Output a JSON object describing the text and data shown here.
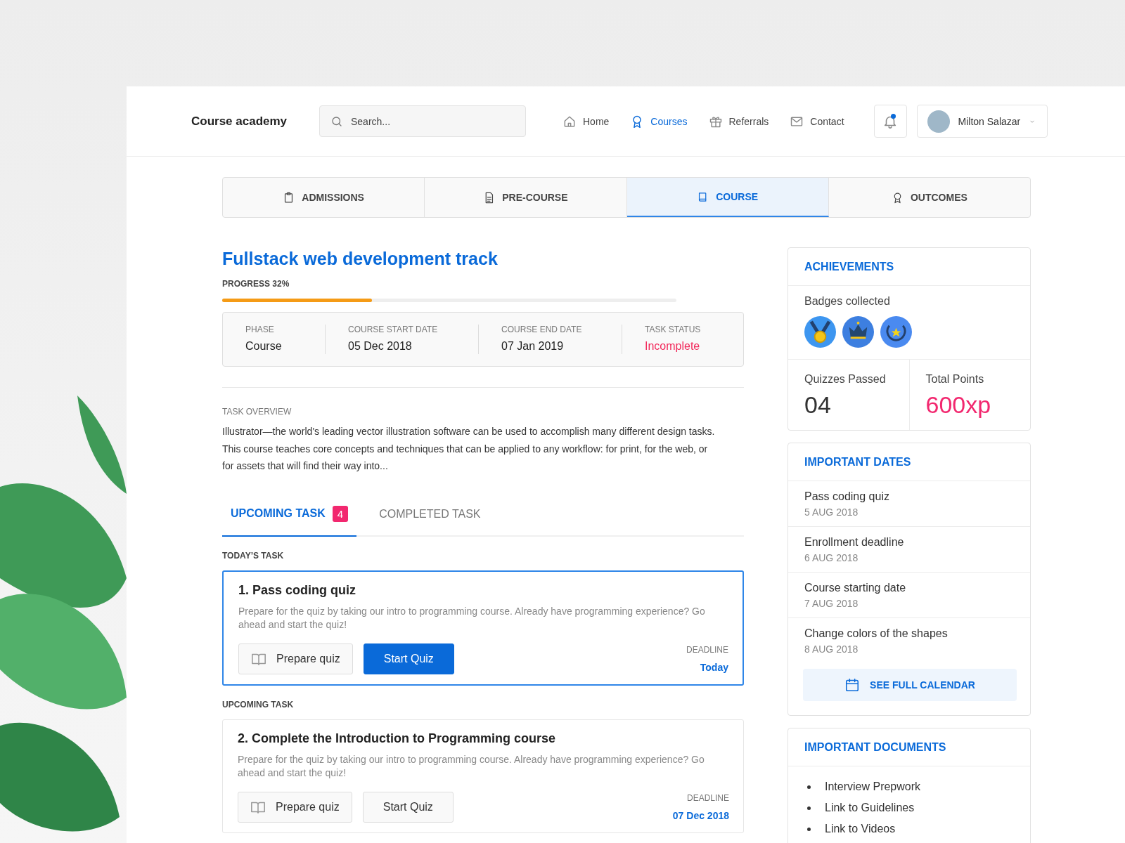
{
  "header": {
    "logo": "Course academy",
    "search": {
      "placeholder": "Search..."
    },
    "nav": [
      {
        "label": "Home",
        "selected": false
      },
      {
        "label": "Courses",
        "selected": true
      },
      {
        "label": "Referrals",
        "selected": false
      },
      {
        "label": "Contact",
        "selected": false
      }
    ],
    "notifications": {
      "unread": true
    },
    "user": {
      "name": "Milton Salazar"
    }
  },
  "section_tabs": [
    {
      "label": "ADMISSIONS",
      "selected": false
    },
    {
      "label": "PRE-COURSE",
      "selected": false
    },
    {
      "label": "COURSE",
      "selected": true
    },
    {
      "label": "OUTCOMES",
      "selected": false
    }
  ],
  "course": {
    "title": "Fullstack web development track",
    "progress_label": "PROGRESS 32%",
    "progress": {
      "level": 0.33
    },
    "info": [
      {
        "label": "PHASE",
        "value": "Course",
        "kind": "plain"
      },
      {
        "label": "COURSE START DATE",
        "value": "05 Dec 2018",
        "kind": "plain"
      },
      {
        "label": "COURSE END DATE",
        "value": "07 Jan 2019",
        "kind": "plain"
      },
      {
        "label": "TASK STATUS",
        "value": "Incomplete",
        "kind": "alert"
      }
    ],
    "overview_label": "TASK OVERVIEW",
    "overview": "Illustrator—the world's leading vector illustration software can be used to accomplish many different design tasks. This course teaches core concepts and techniques that can be applied to any workflow: for print, for the web, or for assets that will find their way into..."
  },
  "task_tabs": [
    {
      "label": "UPCOMING TASK",
      "count": "4",
      "selected": true
    },
    {
      "label": "COMPLETED TASK",
      "selected": false
    }
  ],
  "task_groups": [
    {
      "heading": "TODAY’S TASK",
      "tasks": [
        {
          "title": "1. Pass coding quiz",
          "description": "Prepare for the quiz by taking our intro to programming course. Already have programming experience? Go ahead and start the quiz!",
          "prepare_button": "Prepare quiz",
          "start_button": "Start Quiz",
          "deadline_label": "DEADLINE",
          "deadline": "Today",
          "active": true
        }
      ]
    },
    {
      "heading": "UPCOMING TASK",
      "tasks": [
        {
          "title": "2. Complete the Introduction to Programming course",
          "description": "Prepare for the quiz by taking our intro to programming course. Already have programming experience? Go ahead and start the quiz!",
          "prepare_button": "Prepare quiz",
          "start_button": "Start Quiz",
          "deadline_label": "DEADLINE",
          "deadline": "07 Dec 2018",
          "active": false
        }
      ]
    }
  ],
  "achievements": {
    "title": "ACHIEVEMENTS",
    "badges_label": "Badges collected",
    "stats": [
      {
        "label": "Quizzes Passed",
        "value": "04",
        "kind": "count"
      },
      {
        "label": "Total Points",
        "value": "600xp",
        "kind": "points"
      }
    ]
  },
  "important_dates": {
    "title": "IMPORTANT DATES",
    "items": [
      {
        "title": "Pass coding quiz",
        "date": "5 AUG 2018"
      },
      {
        "title": "Enrollment deadline",
        "date": "6 AUG 2018"
      },
      {
        "title": "Course starting date",
        "date": "7 AUG 2018"
      },
      {
        "title": "Change colors of the shapes",
        "date": "8 AUG 2018"
      }
    ],
    "calendar_button": "SEE FULL CALENDAR"
  },
  "important_documents": {
    "title": "IMPORTANT DOCUMENTS",
    "items": [
      "Interview Prepwork",
      "Link to Guidelines",
      "Link to Videos"
    ]
  }
}
